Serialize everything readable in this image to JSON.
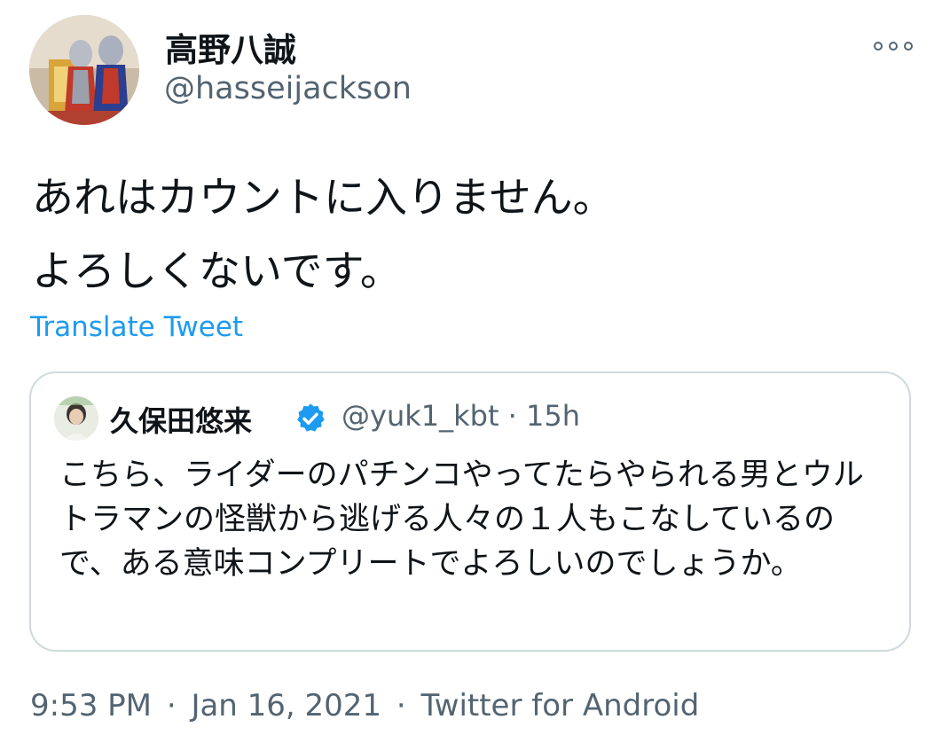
{
  "author": {
    "display_name": "高野八誠",
    "handle": "@hasseijackson"
  },
  "icons": {
    "more": "more-options-icon",
    "verified": "verified-badge-icon"
  },
  "tweet": {
    "text_line1": "あれはカウントに入りません。",
    "text_line2": "よろしくないです。",
    "translate_label": "Translate Tweet"
  },
  "quoted_tweet": {
    "display_name": "久保田悠来",
    "handle": "@yuk1_kbt",
    "separator": "·",
    "time": "15h",
    "text": "こちら、ライダーのパチンコやってたらやられる男とウルトラマンの怪獣から逃げる人々の１人もこなしているので、ある意味コンプリートでよろしいのでしょうか。"
  },
  "footer": {
    "time": "9:53 PM",
    "date": "Jan 16, 2021",
    "source": "Twitter for Android",
    "separator": "·"
  },
  "colors": {
    "link": "#1d9bf0",
    "secondary_text": "#536471",
    "border": "#cfd9de",
    "verified": "#1d9bf0"
  }
}
